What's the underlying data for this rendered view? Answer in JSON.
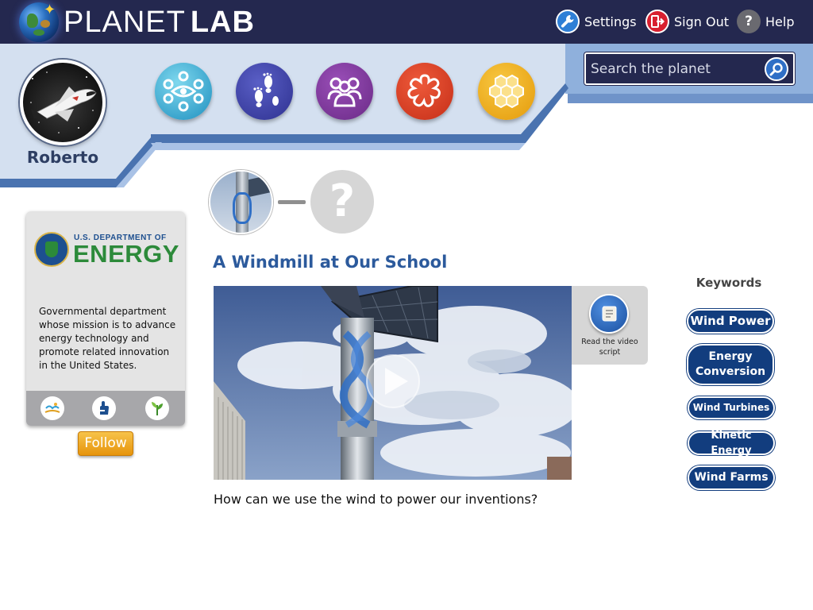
{
  "header": {
    "logo_light": "PLANET",
    "logo_bold": "LAB",
    "settings_label": "Settings",
    "signout_label": "Sign Out",
    "help_label": "Help",
    "help_glyph": "?"
  },
  "profile": {
    "username": "Roberto",
    "avatar_icon": "space-shuttle"
  },
  "nav": {
    "items": [
      {
        "icon": "network-eye-icon",
        "color": "#1e8fbf"
      },
      {
        "icon": "footprints-icon",
        "color": "#2e3190"
      },
      {
        "icon": "group-icon",
        "color": "#6a2a86"
      },
      {
        "icon": "flower-icon",
        "color": "#c52e18"
      },
      {
        "icon": "honeycomb-icon",
        "color": "#e49a0a"
      }
    ]
  },
  "search": {
    "placeholder": "Search the planet"
  },
  "sponsor": {
    "logo_line1": "U.S. DEPARTMENT OF",
    "logo_line2": "ENERGY",
    "description": "Governmental department whose mission is to advance energy technology and promote related innovation in the United States.",
    "categories": [
      "landscape-icon",
      "hand-icon",
      "plant-icon"
    ],
    "follow_label": "Follow"
  },
  "journey": {
    "next_glyph": "?"
  },
  "content": {
    "title": "A Windmill at Our School",
    "script_label": "Read the video script",
    "question": "How can we use the wind to power our inventions?"
  },
  "keywords": {
    "title": "Keywords",
    "items": [
      "Wind Power",
      "Energy Conversion",
      "Wind Turbines",
      "Kinetic Energy",
      "Wind Farms"
    ]
  },
  "colors": {
    "topbar": "#24284f",
    "band": "#d4e0f0",
    "band_accent": "#4a73b0",
    "title_blue": "#2c5a9c",
    "keyword_bg": "#123d7e",
    "follow": "#f0a820"
  }
}
